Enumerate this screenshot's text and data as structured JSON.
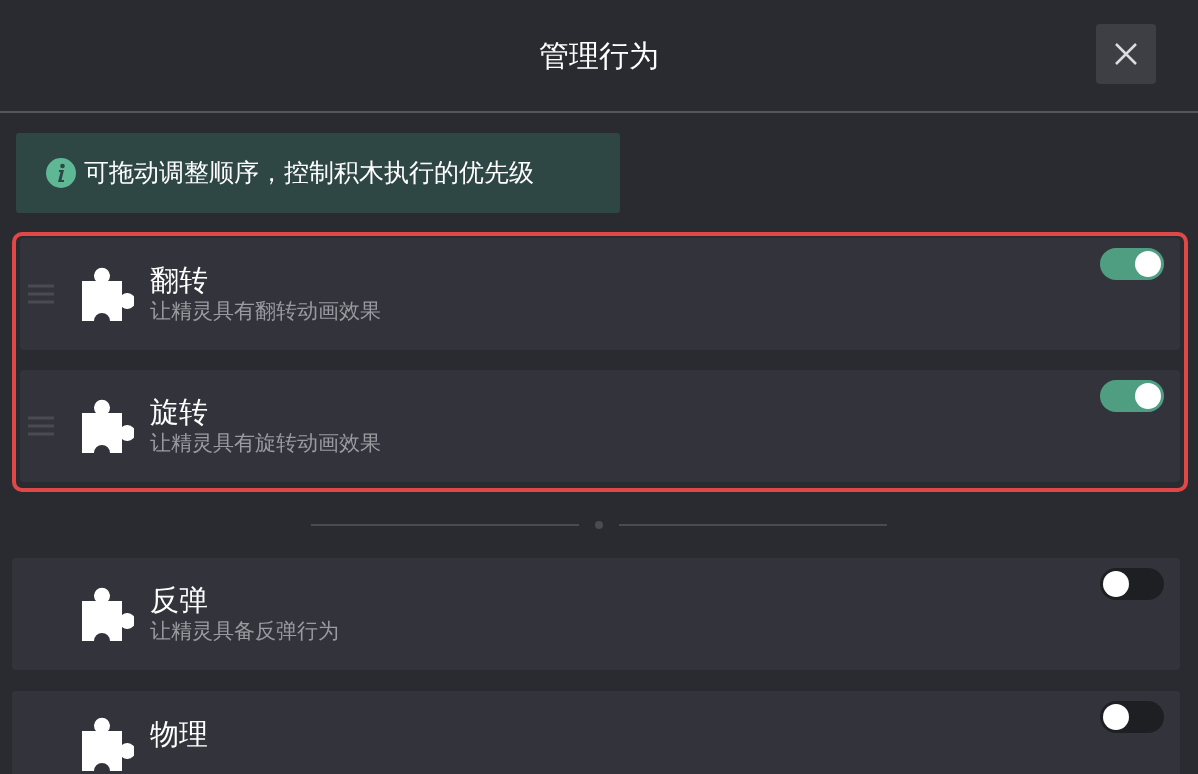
{
  "header": {
    "title": "管理行为"
  },
  "notice": {
    "text": "可拖动调整顺序，控制积木执行的优先级"
  },
  "ordered_behaviors": [
    {
      "name": "翻转",
      "description": "让精灵具有翻转动画效果",
      "on": true
    },
    {
      "name": "旋转",
      "description": "让精灵具有旋转动画效果",
      "on": true
    }
  ],
  "other_behaviors": [
    {
      "name": "反弹",
      "description": "让精灵具备反弹行为",
      "on": false
    },
    {
      "name": "物理",
      "on": false
    }
  ]
}
